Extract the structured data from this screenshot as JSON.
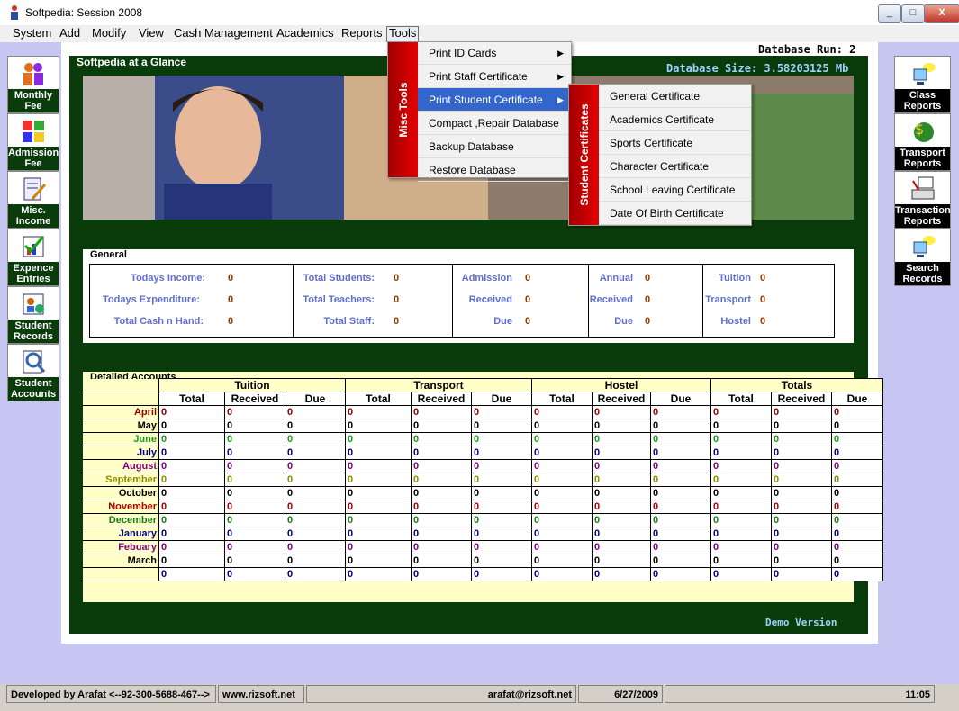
{
  "window": {
    "title": "Softpedia: Session 2008",
    "minimize": "_",
    "maximize": "□",
    "close": "X"
  },
  "menu": [
    "System",
    "Add",
    "Modify",
    "View",
    "Cash Management",
    "Academics",
    "Reports",
    "Tools"
  ],
  "header": {
    "database_run": "Database Run: 2",
    "glance_title": "Softpedia at a Glance",
    "database_size": "Database Size: 3.58203125  Mb",
    "demo": "Demo Version"
  },
  "left_toolbar": [
    "Monthly Fee",
    "Admission Fee",
    "Misc. Income",
    "Expence Entries",
    "Student Records",
    "Student Accounts"
  ],
  "right_toolbar": [
    "Class Reports",
    "Transport Reports",
    "Transaction Reports",
    "Search Records"
  ],
  "general": {
    "legend": "General",
    "col1": [
      [
        "Todays Income:",
        "0"
      ],
      [
        "Todays Expenditure:",
        "0"
      ],
      [
        "Total Cash n Hand:",
        "0"
      ]
    ],
    "col2": [
      [
        "Total Students:",
        "0"
      ],
      [
        "Total Teachers:",
        "0"
      ],
      [
        "Total Staff:",
        "0"
      ]
    ],
    "col3": [
      [
        "Admission",
        "0"
      ],
      [
        "Received",
        "0"
      ],
      [
        "Due",
        "0"
      ]
    ],
    "col4": [
      [
        "Annual",
        "0"
      ],
      [
        "Received",
        "0"
      ],
      [
        "Due",
        "0"
      ]
    ],
    "col5": [
      [
        "Tuition",
        "0"
      ],
      [
        "Transport",
        "0"
      ],
      [
        "Hostel",
        "0"
      ]
    ]
  },
  "detail": {
    "legend": "Detailed Accounts",
    "groups": [
      "Tuition",
      "Transport",
      "Hostel",
      "Totals"
    ],
    "sub": [
      "Total",
      "Received",
      "Due"
    ],
    "months": [
      {
        "name": "April",
        "color": "#8b0000"
      },
      {
        "name": "May",
        "color": "#000000"
      },
      {
        "name": "June",
        "color": "#1a9a1a"
      },
      {
        "name": "July",
        "color": "#000080"
      },
      {
        "name": "August",
        "color": "#800080"
      },
      {
        "name": "September",
        "color": "#8b8b00"
      },
      {
        "name": "October",
        "color": "#000000"
      },
      {
        "name": "November",
        "color": "#b00000"
      },
      {
        "name": "December",
        "color": "#1a7a1a"
      },
      {
        "name": "January",
        "color": "#000080"
      },
      {
        "name": "Febuary",
        "color": "#800080"
      },
      {
        "name": "March",
        "color": "#000000"
      },
      {
        "name": "",
        "color": "#000080"
      }
    ],
    "cell_value": "0"
  },
  "tools_menu": {
    "side_label": "Misc Tools",
    "items": [
      {
        "label": "Print ID Cards",
        "submenu": true
      },
      {
        "label": "Print Staff Certificate",
        "submenu": true
      },
      {
        "label": "Print Student Certificate",
        "submenu": true
      },
      {
        "label": "Compact ,Repair Database",
        "submenu": false
      },
      {
        "label": "Backup Database",
        "submenu": false
      },
      {
        "label": "Restore Database",
        "submenu": false
      }
    ]
  },
  "cert_menu": {
    "side_label": "Student Certificates",
    "items": [
      "General Certificate",
      "Academics Certificate",
      "Sports Certificate",
      "Character Certificate",
      "School Leaving Certificate",
      "Date Of Birth Certificate"
    ]
  },
  "status": {
    "developer": "Developed by Arafat <--92-300-5688-467-->",
    "website": "www.rizsoft.net",
    "email": "arafat@rizsoft.net",
    "date": "6/27/2009",
    "time": "11:05"
  },
  "colors": {
    "dark_green": "#0a3b0a",
    "label_blue": "#5f6fd0",
    "menu_red": "#e50000",
    "highlight": "#3366cc"
  }
}
